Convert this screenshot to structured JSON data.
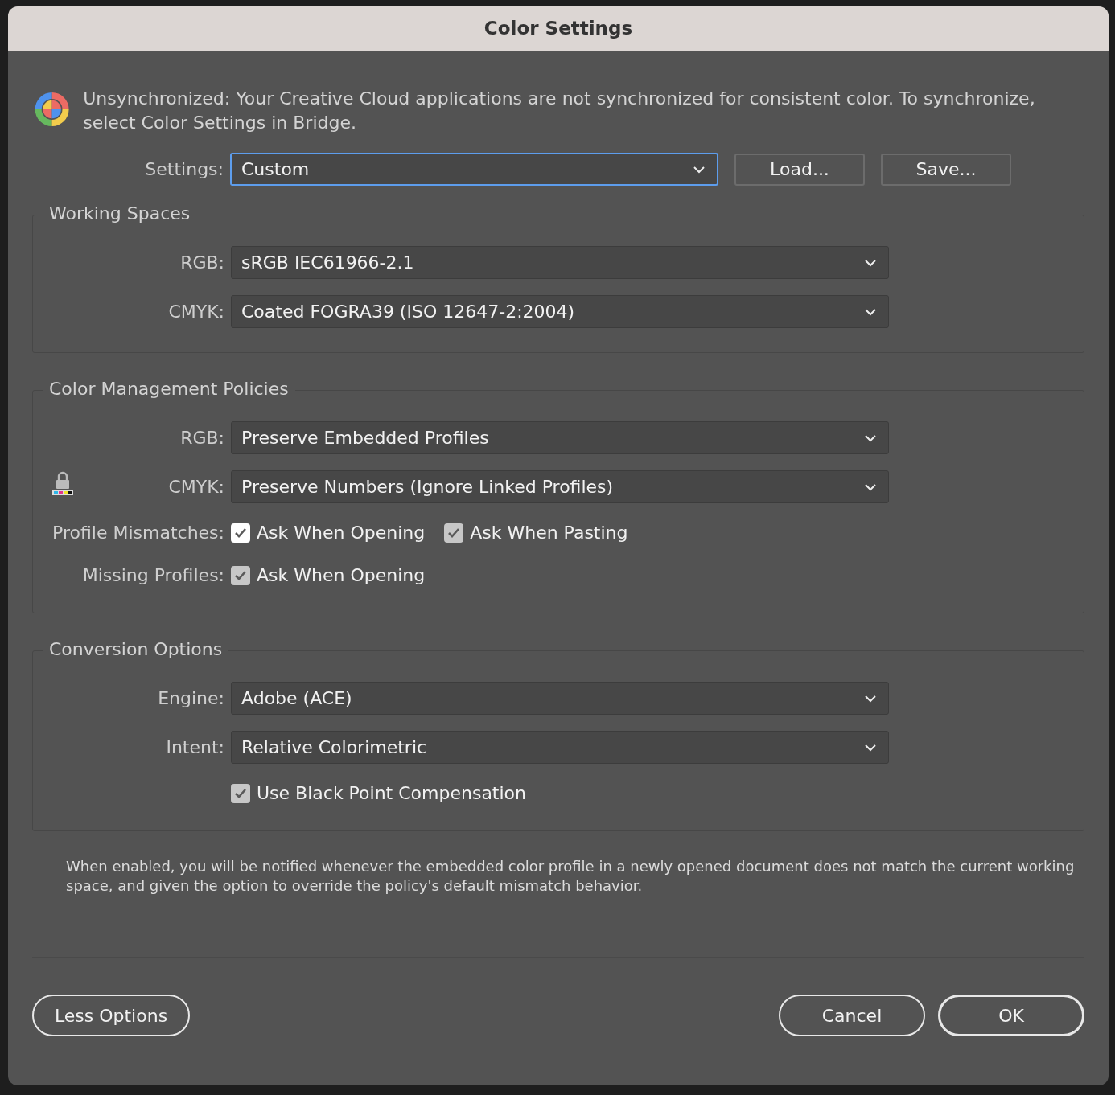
{
  "window": {
    "title": "Color Settings"
  },
  "message": "Unsynchronized: Your Creative Cloud applications are not synchronized for consistent color. To synchronize, select Color Settings in Bridge.",
  "settings": {
    "label": "Settings:",
    "value": "Custom",
    "focused": true
  },
  "top_buttons": [
    "Load...",
    "Save..."
  ],
  "sections": [
    {
      "title": "Working Spaces",
      "rows": [
        {
          "kind": "select",
          "label": "RGB:",
          "value": "sRGB IEC61966-2.1"
        },
        {
          "kind": "select",
          "label": "CMYK:",
          "value": "Coated FOGRA39 (ISO 12647-2:2004)"
        }
      ]
    },
    {
      "title": "Color Management Policies",
      "rows": [
        {
          "kind": "select",
          "label": "RGB:",
          "value": "Preserve Embedded Profiles"
        },
        {
          "kind": "select",
          "label": "CMYK:",
          "value": "Preserve Numbers (Ignore Linked Profiles)",
          "lock": true
        },
        {
          "kind": "checks",
          "label": "Profile Mismatches:",
          "checks": [
            {
              "label": "Ask When Opening",
              "checked": true,
              "focused": true
            },
            {
              "label": "Ask When Pasting",
              "checked": true,
              "focused": false
            }
          ]
        },
        {
          "kind": "checks",
          "label": "Missing Profiles:",
          "checks": [
            {
              "label": "Ask When Opening",
              "checked": true,
              "focused": false
            }
          ]
        }
      ]
    },
    {
      "title": "Conversion Options",
      "rows": [
        {
          "kind": "select",
          "label": "Engine:",
          "value": "Adobe (ACE)"
        },
        {
          "kind": "select",
          "label": "Intent:",
          "value": "Relative Colorimetric"
        },
        {
          "kind": "checks",
          "checks": [
            {
              "label": "Use Black Point Compensation",
              "checked": true,
              "focused": false
            }
          ]
        }
      ]
    }
  ],
  "description": "When enabled, you will be notified whenever the embedded color profile in a newly opened document does not match the current working space, and given the option to override the policy's default mismatch behavior.",
  "footer": {
    "left_buttons": [
      {
        "label": "Less Options",
        "default": false
      }
    ],
    "right_buttons": [
      {
        "label": "Cancel",
        "default": false
      },
      {
        "label": "OK",
        "default": true
      }
    ]
  }
}
